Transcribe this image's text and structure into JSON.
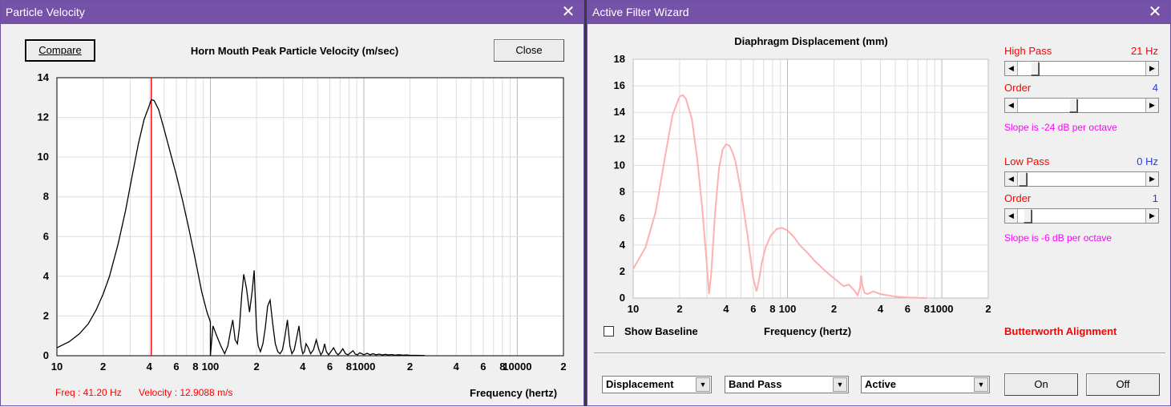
{
  "particle_window": {
    "title": "Particle Velocity",
    "compare_label": "Compare",
    "close_label": "Close",
    "chart_title": "Horn Mouth Peak Particle Velocity (m/sec)",
    "freq_readout": "Freq : 41.20 Hz",
    "velocity_readout": "Velocity : 12.9088 m/s",
    "x_axis_label": "Frequency (hertz)",
    "x_ticks": [
      "10",
      "2",
      "4",
      "6",
      "8",
      "100",
      "2",
      "4",
      "6",
      "8",
      "1000",
      "2",
      "4",
      "6",
      "8",
      "10000",
      "2"
    ],
    "y_ticks": [
      "0",
      "2",
      "4",
      "6",
      "8",
      "10",
      "12",
      "14"
    ]
  },
  "filter_window": {
    "title": "Active Filter Wizard",
    "chart_title": "Diaphragm Displacement (mm)",
    "x_axis_label": "Frequency (hertz)",
    "x_ticks": [
      "10",
      "2",
      "4",
      "6",
      "8",
      "100",
      "2",
      "4",
      "6",
      "8",
      "1000",
      "2"
    ],
    "y_ticks": [
      "0",
      "2",
      "4",
      "6",
      "8",
      "10",
      "12",
      "14",
      "16",
      "18"
    ],
    "show_baseline_label": "Show Baseline",
    "high_pass": {
      "label": "High Pass",
      "value": "21 Hz",
      "position": 0.1
    },
    "high_pass_order": {
      "label": "Order",
      "value": "4",
      "position": 0.42
    },
    "high_pass_slope": "Slope is -24 dB per octave",
    "low_pass": {
      "label": "Low Pass",
      "value": "0 Hz",
      "position": 0.0
    },
    "low_pass_order": {
      "label": "Order",
      "value": "1",
      "position": 0.04
    },
    "low_pass_slope": "Slope is -6 dB per octave",
    "alignment": "Butterworth Alignment",
    "select_mode": "Displacement",
    "select_band": "Band Pass",
    "select_type": "Active",
    "on_label": "On",
    "off_label": "Off"
  },
  "colors": {
    "title_bar": "#7551a8",
    "velocity_curve": "#000000",
    "cursor_line": "#ff0000",
    "displacement_curve": "#ffb0b0"
  },
  "chart_data": [
    {
      "type": "line",
      "title": "Horn Mouth Peak Particle Velocity (m/sec)",
      "xlabel": "Frequency (hertz)",
      "ylabel": "",
      "x_scale": "log",
      "xlim": [
        10,
        20000
      ],
      "ylim": [
        0,
        14
      ],
      "grid": true,
      "cursor_x": 41.2,
      "series": [
        {
          "x": [
            10,
            12,
            14,
            16,
            18,
            20,
            22,
            25,
            28,
            31,
            34,
            37,
            40,
            41.2,
            43,
            46,
            50,
            55,
            60,
            66,
            72,
            80,
            88,
            95,
            100,
            100.1,
            104,
            110,
            117,
            124,
            130,
            135,
            140,
            145,
            150,
            155,
            160,
            165,
            172,
            180,
            187,
            193,
            200,
            205,
            212,
            220,
            228,
            236,
            245,
            255,
            265,
            275,
            285,
            295,
            305,
            318,
            330,
            340,
            352,
            365,
            378,
            390,
            400,
            410,
            420,
            435,
            450,
            470,
            490,
            510,
            525,
            540,
            555,
            570,
            590,
            610,
            635,
            660,
            680,
            700,
            730,
            760,
            790,
            820,
            850,
            880,
            910,
            940,
            970,
            1000,
            1050,
            1100,
            1150,
            1200,
            1260,
            1320,
            1380,
            1450,
            1520,
            1600,
            1700,
            1800,
            1900,
            2000,
            2200,
            2500
          ],
          "y": [
            0.4,
            0.7,
            1.1,
            1.6,
            2.3,
            3.1,
            4.0,
            5.6,
            7.3,
            9.1,
            10.7,
            11.9,
            12.6,
            12.9,
            12.85,
            12.4,
            11.4,
            10.2,
            9.1,
            7.8,
            6.5,
            4.8,
            3.2,
            2.2,
            1.7,
            0.0,
            1.5,
            1.0,
            0.5,
            0.1,
            0.5,
            1.2,
            1.8,
            0.8,
            0.6,
            1.5,
            3.0,
            4.1,
            3.4,
            2.2,
            3.2,
            4.3,
            1.3,
            0.5,
            0.2,
            0.6,
            1.4,
            2.5,
            2.8,
            1.6,
            0.6,
            0.2,
            0.1,
            0.3,
            0.9,
            1.8,
            0.5,
            0.1,
            0.3,
            0.9,
            1.5,
            0.5,
            0.1,
            0.2,
            0.6,
            0.4,
            0.1,
            0.3,
            0.8,
            0.3,
            0.05,
            0.2,
            0.6,
            0.2,
            0.05,
            0.2,
            0.4,
            0.15,
            0.05,
            0.15,
            0.35,
            0.1,
            0.05,
            0.15,
            0.25,
            0.08,
            0.05,
            0.15,
            0.1,
            0.05,
            0.12,
            0.05,
            0.1,
            0.05,
            0.08,
            0.04,
            0.07,
            0.04,
            0.06,
            0.03,
            0.05,
            0.03,
            0.04,
            0.02,
            0.02,
            0.01
          ]
        }
      ]
    },
    {
      "type": "line",
      "title": "Diaphragm Displacement (mm)",
      "xlabel": "Frequency (hertz)",
      "ylabel": "",
      "x_scale": "log",
      "xlim": [
        10,
        2000
      ],
      "ylim": [
        0,
        18
      ],
      "grid": true,
      "series": [
        {
          "x": [
            10,
            12,
            14,
            16,
            18,
            20,
            21,
            22,
            24,
            26,
            28,
            30,
            31,
            32,
            34,
            36,
            38,
            40,
            42,
            44,
            46,
            50,
            55,
            60,
            63,
            65,
            68,
            72,
            78,
            85,
            92,
            100,
            110,
            120,
            135,
            150,
            170,
            190,
            210,
            230,
            250,
            270,
            285,
            295,
            300,
            305,
            315,
            330,
            360,
            400,
            450,
            500,
            600,
            700,
            800
          ],
          "y": [
            2.2,
            3.8,
            6.5,
            10.5,
            13.8,
            15.2,
            15.3,
            15.0,
            13.5,
            10.5,
            6.8,
            2.5,
            0.3,
            1.8,
            6.5,
            9.8,
            11.2,
            11.6,
            11.5,
            11.0,
            10.3,
            8.0,
            4.8,
            1.5,
            0.5,
            1.2,
            2.6,
            3.8,
            4.7,
            5.2,
            5.3,
            5.1,
            4.6,
            4.0,
            3.4,
            2.8,
            2.2,
            1.7,
            1.3,
            0.9,
            1.0,
            0.6,
            0.2,
            0.8,
            1.7,
            1.0,
            0.4,
            0.3,
            0.5,
            0.3,
            0.2,
            0.1,
            0.05,
            0.02,
            0.0
          ]
        }
      ]
    }
  ]
}
